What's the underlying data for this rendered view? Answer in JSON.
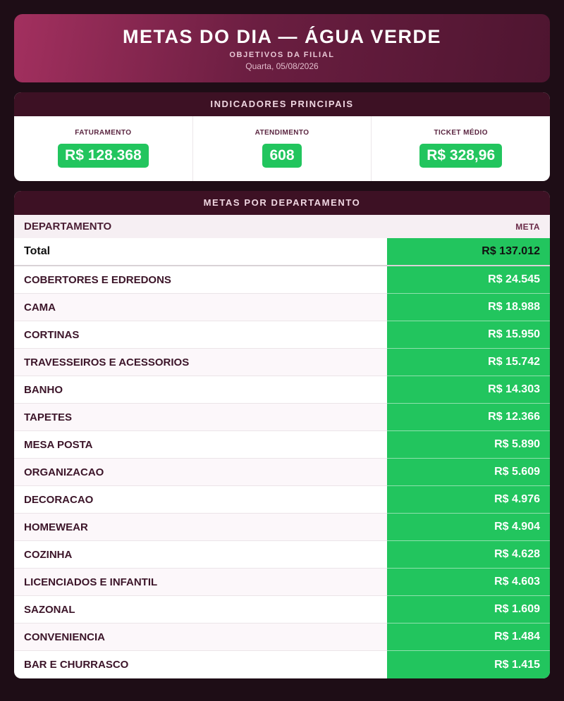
{
  "header": {
    "title": "METAS DO DIA — ÁGUA VERDE",
    "subtitle": "OBJETIVOS DA FILIAL",
    "date": "Quarta, 05/08/2026"
  },
  "indicators": {
    "title": "INDICADORES PRINCIPAIS",
    "items": [
      {
        "label": "FATURAMENTO",
        "value": "R$ 128.368"
      },
      {
        "label": "ATENDIMENTO",
        "value": "608"
      },
      {
        "label": "TICKET MÉDIO",
        "value": "R$ 328,96"
      }
    ]
  },
  "departments": {
    "title": "METAS POR DEPARTAMENTO",
    "col_department": "DEPARTAMENTO",
    "col_meta": "META",
    "total": {
      "name": "Total",
      "value": "R$ 137.012"
    },
    "rows": [
      {
        "name": "COBERTORES E EDREDONS",
        "value": "R$ 24.545"
      },
      {
        "name": "CAMA",
        "value": "R$ 18.988"
      },
      {
        "name": "CORTINAS",
        "value": "R$ 15.950"
      },
      {
        "name": "TRAVESSEIROS E ACESSORIOS",
        "value": "R$ 15.742"
      },
      {
        "name": "BANHO",
        "value": "R$ 14.303"
      },
      {
        "name": "TAPETES",
        "value": "R$ 12.366"
      },
      {
        "name": "MESA POSTA",
        "value": "R$ 5.890"
      },
      {
        "name": "ORGANIZACAO",
        "value": "R$ 5.609"
      },
      {
        "name": "DECORACAO",
        "value": "R$ 4.976"
      },
      {
        "name": "HOMEWEAR",
        "value": "R$ 4.904"
      },
      {
        "name": "COZINHA",
        "value": "R$ 4.628"
      },
      {
        "name": "LICENCIADOS E INFANTIL",
        "value": "R$ 4.603"
      },
      {
        "name": "SAZONAL",
        "value": "R$ 1.609"
      },
      {
        "name": "CONVENIENCIA",
        "value": "R$ 1.484"
      },
      {
        "name": "BAR E CHURRASCO",
        "value": "R$ 1.415"
      }
    ]
  },
  "colors": {
    "accent_green": "#22c55e",
    "header_dark": "#3d1124",
    "background": "#1e0d16"
  }
}
